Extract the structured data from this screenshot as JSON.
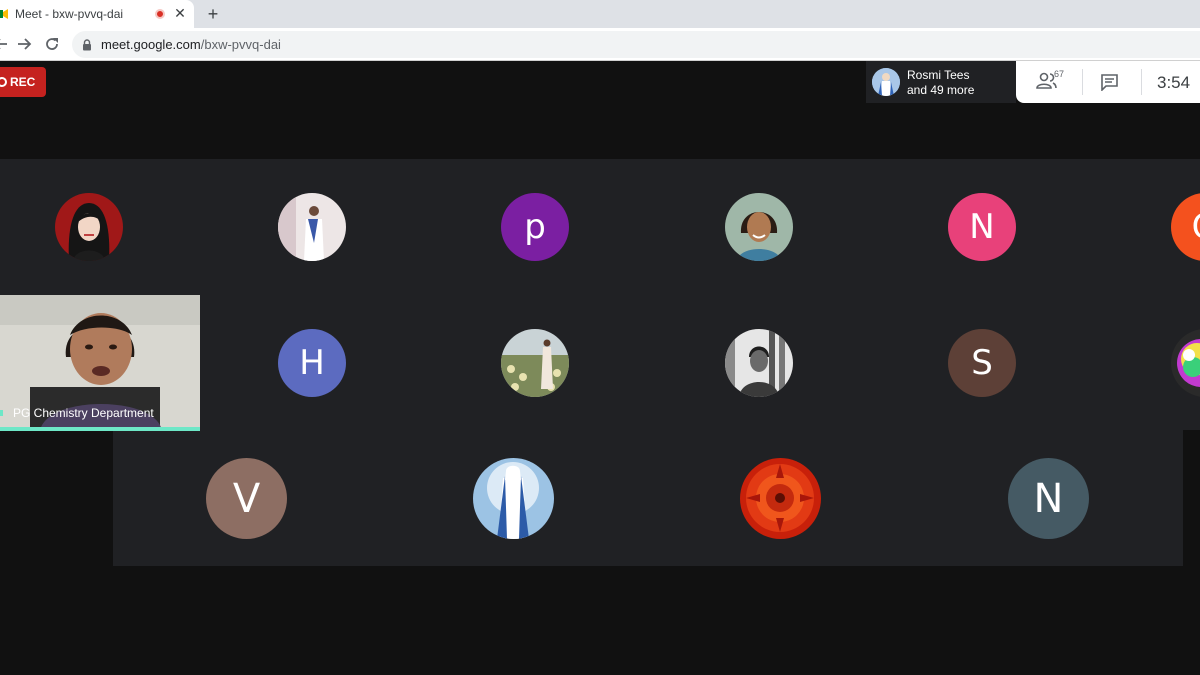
{
  "browser": {
    "tab_title": "Meet - bxw-pvvq-dai",
    "tab_close": "✕",
    "new_tab": "+",
    "url_host": "meet.google.com",
    "url_path": "/bxw-pvvq-dai"
  },
  "meeting": {
    "rec_label": "REC",
    "speaker_name": "Rosmi Tees",
    "speaker_more": "and 49 more",
    "people_count": "67",
    "clock": "3:54"
  },
  "self_tile": {
    "name": "PG Chemistry Department"
  },
  "participants": {
    "row1": [
      {
        "type": "photo",
        "icon": "cartoon-woman-avatar"
      },
      {
        "type": "photo",
        "icon": "woman-saree-avatar"
      },
      {
        "type": "letter",
        "letter": "p",
        "color": "#7b1fa2"
      },
      {
        "type": "photo",
        "icon": "woman-portrait-avatar"
      },
      {
        "type": "letter",
        "letter": "N",
        "color": "#e8417a"
      },
      {
        "type": "letter",
        "letter": "O",
        "color": "#f4511e"
      }
    ],
    "row2": [
      {
        "type": "letter",
        "letter": "H",
        "color": "#5c6bc0"
      },
      {
        "type": "photo",
        "icon": "field-portrait-avatar"
      },
      {
        "type": "photo",
        "icon": "man-bw-avatar"
      },
      {
        "type": "letter",
        "letter": "S",
        "color": "#5d4037"
      },
      {
        "type": "photo",
        "icon": "colorful-avatar"
      }
    ],
    "row3": [
      {
        "type": "letter",
        "letter": "V",
        "color": "#8d6e63"
      },
      {
        "type": "photo",
        "icon": "mary-statue-avatar"
      },
      {
        "type": "photo",
        "icon": "red-flower-avatar"
      },
      {
        "type": "letter",
        "letter": "N",
        "color": "#455a64"
      }
    ]
  },
  "colors": {
    "rec": "#c5221f",
    "active_speaker": "#6ee7c7"
  }
}
